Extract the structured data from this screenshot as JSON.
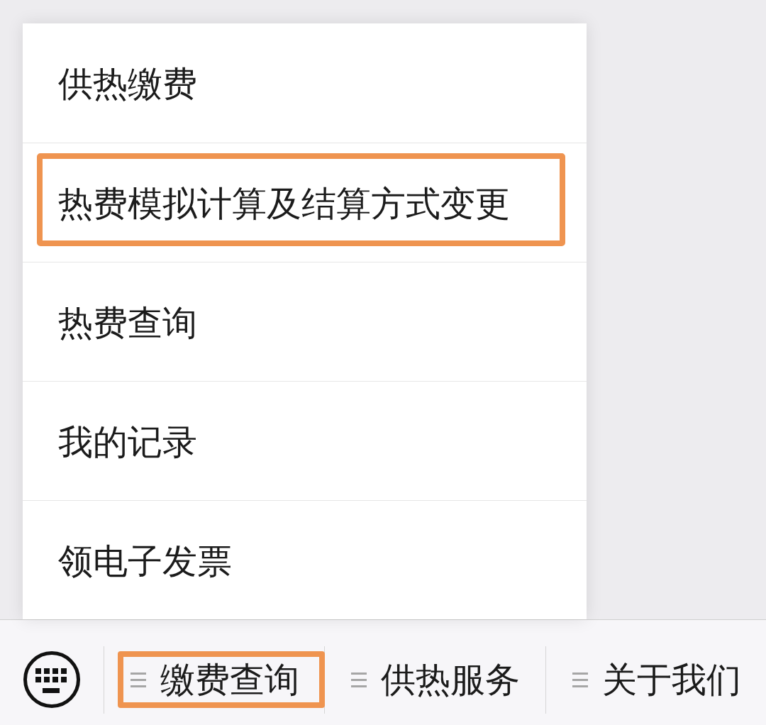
{
  "popup_menu": {
    "items": [
      {
        "label": "供热缴费",
        "highlighted": false
      },
      {
        "label": "热费模拟计算及结算方式变更",
        "highlighted": true
      },
      {
        "label": "热费查询",
        "highlighted": false
      },
      {
        "label": "我的记录",
        "highlighted": false
      },
      {
        "label": "领电子发票",
        "highlighted": false
      }
    ]
  },
  "menu_bar": {
    "items": [
      {
        "label": "缴费查询",
        "highlighted": true
      },
      {
        "label": "供热服务",
        "highlighted": false
      },
      {
        "label": "关于我们",
        "highlighted": false
      }
    ]
  }
}
